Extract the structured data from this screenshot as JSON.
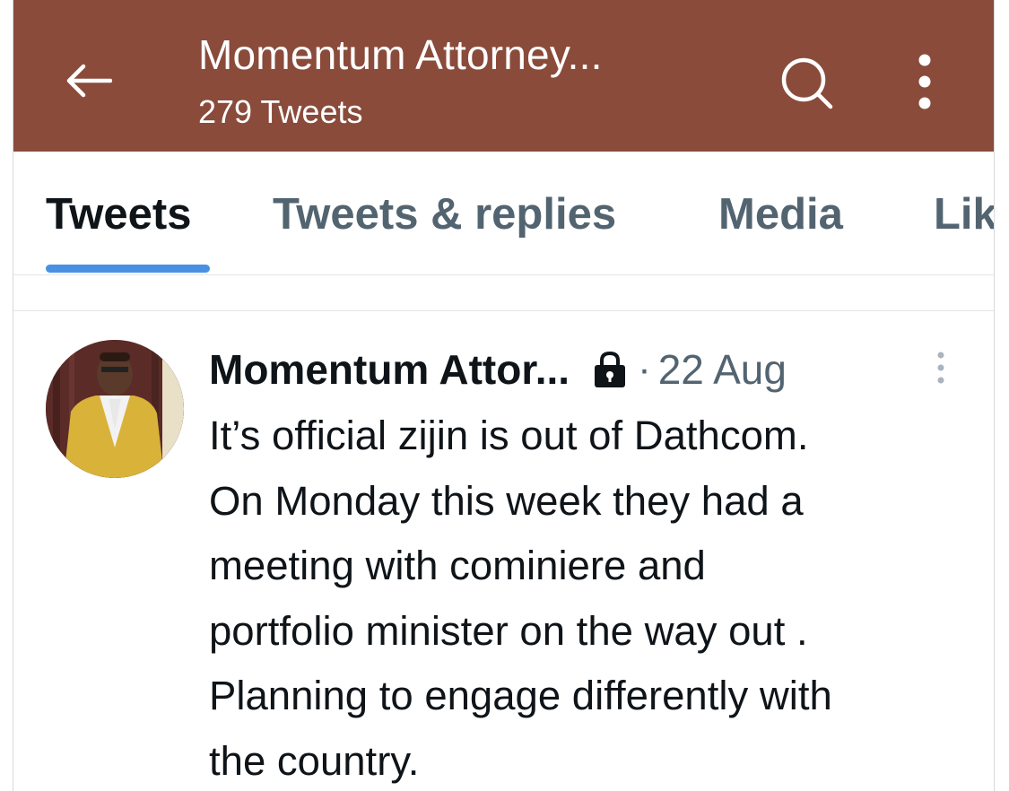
{
  "colors": {
    "header_bg": "#8a4b3b",
    "accent": "#4a90e2",
    "text_primary": "#0f1419",
    "text_secondary": "#536471"
  },
  "header": {
    "back_icon": "arrow-left-icon",
    "title": "Momentum Attorney...",
    "tweet_count": "279 Tweets",
    "search_icon": "search-icon",
    "more_icon": "more-vertical-icon"
  },
  "tabs": [
    {
      "label": "Tweets",
      "active": true
    },
    {
      "label": "Tweets & replies",
      "active": false
    },
    {
      "label": "Media",
      "active": false
    },
    {
      "label": "Lik",
      "active": false
    }
  ],
  "tweet": {
    "author": "Momentum Attor...",
    "protected_icon": "lock-icon",
    "separator": "·",
    "date": "22 Aug",
    "more_icon": "more-vertical-icon",
    "text_lines": [
      "It’s official zijin is out of Dathcom.",
      "On Monday this week they had a",
      "meeting with cominiere and",
      "portfolio minister on the way out .",
      "Planning to engage differently with",
      "the country."
    ]
  }
}
